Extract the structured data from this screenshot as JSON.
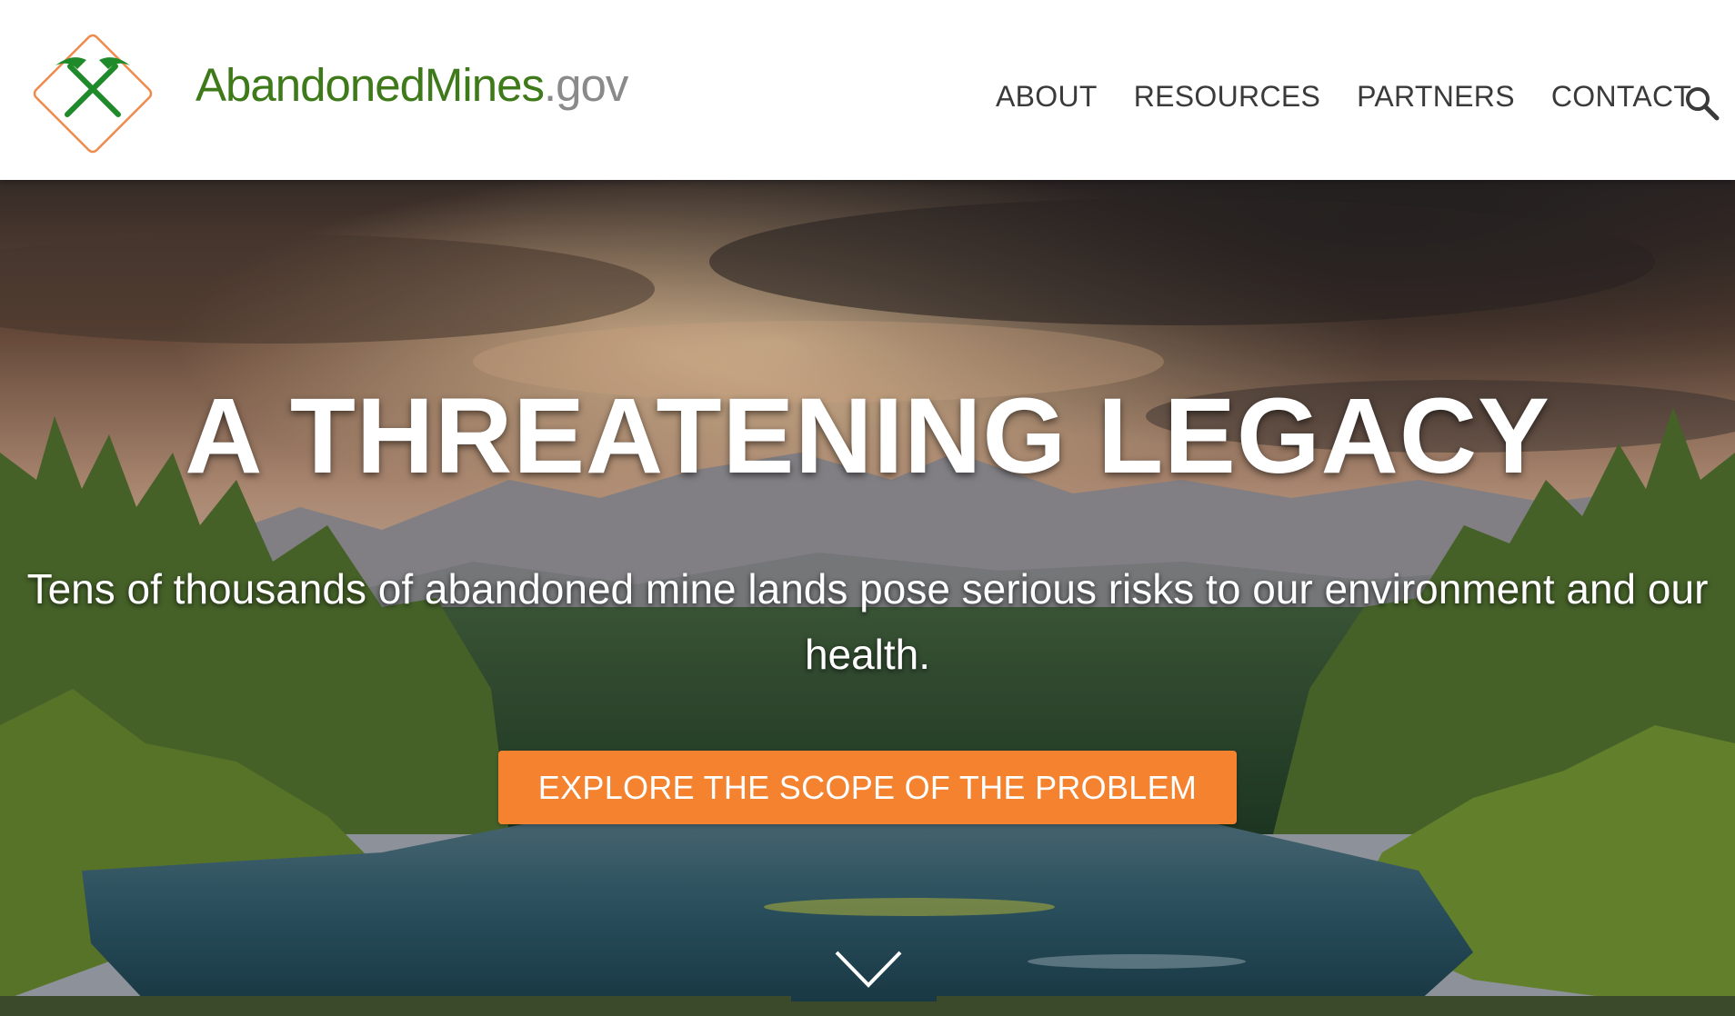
{
  "header": {
    "logo": {
      "brand": "AbandonedMines",
      "tld": ".gov",
      "icon": "crossed-pickaxes-icon"
    },
    "nav": [
      {
        "label": "ABOUT"
      },
      {
        "label": "RESOURCES"
      },
      {
        "label": "PARTNERS"
      },
      {
        "label": "CONTACT"
      }
    ],
    "search_icon": "search-icon"
  },
  "hero": {
    "title": "A THREATENING LEGACY",
    "subtitle": "Tens of thousands of abandoned mine lands pose serious risks to our environment and our health.",
    "cta_label": "EXPLORE THE SCOPE OF THE PROBLEM",
    "scroll_icon": "chevron-down-icon"
  },
  "colors": {
    "brand_green": "#3f7a1a",
    "logo_orange": "#f08a4b",
    "tld_gray": "#8a8a8a",
    "cta_orange": "#f4822f",
    "footer_green": "#3b4a2b"
  }
}
